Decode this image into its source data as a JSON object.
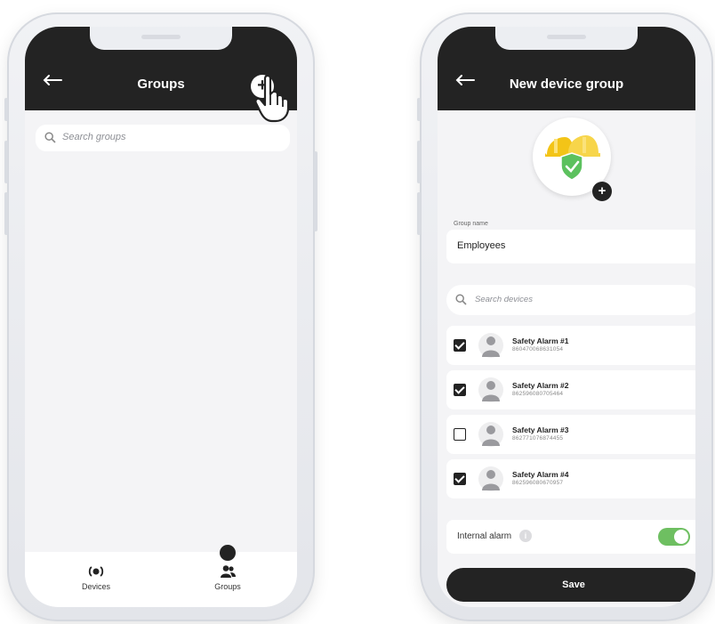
{
  "groups_screen": {
    "title": "Groups",
    "back_icon": "arrow-left-icon",
    "add_icon": "plus-icon",
    "pointer_icon": "hand-pointer-icon",
    "search_placeholder": "Search groups",
    "tabs": [
      {
        "label": "Devices",
        "icon": "devices-icon"
      },
      {
        "label": "Groups",
        "icon": "groups-icon",
        "active": true
      }
    ]
  },
  "new_group_screen": {
    "title": "New device group",
    "back_icon": "arrow-left-icon",
    "avatar_icon": "hardhat-shield-icon",
    "avatar_add_icon": "plus-icon",
    "group_name_label": "Group name",
    "group_name_value": "Employees",
    "search_placeholder": "Search devices",
    "devices": [
      {
        "name": "Safety Alarm #1",
        "serial": "860470068631054",
        "checked": true
      },
      {
        "name": "Safety Alarm #2",
        "serial": "862596080705464",
        "checked": true
      },
      {
        "name": "Safety Alarm #3",
        "serial": "862771076874455",
        "checked": false
      },
      {
        "name": "Safety Alarm #4",
        "serial": "862596080670957",
        "checked": true
      }
    ],
    "internal_alarm_label": "Internal alarm",
    "internal_alarm_on": true,
    "save_label": "Save"
  },
  "colors": {
    "header": "#232323",
    "toggle_on": "#6ebf61",
    "helmet": "#f3c417",
    "shield": "#5cc15e"
  }
}
